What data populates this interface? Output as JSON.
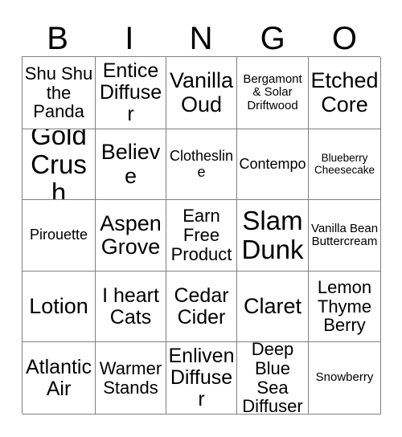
{
  "card": {
    "header_letters": [
      "B",
      "I",
      "N",
      "G",
      "O"
    ],
    "rows": [
      [
        {
          "label": "Shu Shu the Panda",
          "size": "s-md"
        },
        {
          "label": "Entice Diffuser",
          "size": "s-lg"
        },
        {
          "label": "Vanilla Oud",
          "size": "s-xl"
        },
        {
          "label": "Bergamont & Solar Driftwood",
          "size": "s-xs"
        },
        {
          "label": "Etched Core",
          "size": "s-xl"
        }
      ],
      [
        {
          "label": "Gold Crush",
          "size": "s-xxl"
        },
        {
          "label": "Believe",
          "size": "s-xl"
        },
        {
          "label": "Clothesline",
          "size": "s-sm"
        },
        {
          "label": "Contempo",
          "size": "s-sm"
        },
        {
          "label": "Blueberry Cheesecake",
          "size": "s-xxs"
        }
      ],
      [
        {
          "label": "Pirouette",
          "size": "s-sm"
        },
        {
          "label": "Aspen Grove",
          "size": "s-xl"
        },
        {
          "label": "Earn Free Product",
          "size": "s-md"
        },
        {
          "label": "Slam Dunk",
          "size": "s-xxl"
        },
        {
          "label": "Vanilla Bean Buttercream",
          "size": "s-xs"
        }
      ],
      [
        {
          "label": "Lotion",
          "size": "s-xl"
        },
        {
          "label": "I heart Cats",
          "size": "s-lg"
        },
        {
          "label": "Cedar Cider",
          "size": "s-lg"
        },
        {
          "label": "Claret",
          "size": "s-xl"
        },
        {
          "label": "Lemon Thyme Berry",
          "size": "s-md"
        }
      ],
      [
        {
          "label": "Atlantic Air",
          "size": "s-lg"
        },
        {
          "label": "Warmer Stands",
          "size": "s-md"
        },
        {
          "label": "Enliven Diffuser",
          "size": "s-lg"
        },
        {
          "label": "Deep Blue Sea Diffuser",
          "size": "s-md"
        },
        {
          "label": "Snowberry",
          "size": "s-xs"
        }
      ]
    ]
  },
  "colors": {
    "background": "#ffffff",
    "text": "#000000",
    "grid_line": "#808080"
  }
}
